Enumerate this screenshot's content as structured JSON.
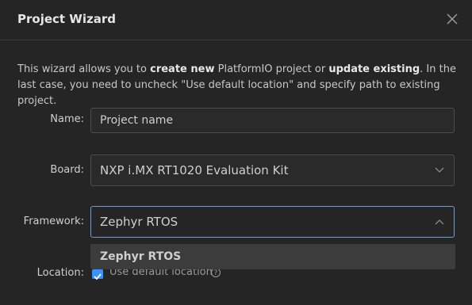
{
  "dialog": {
    "title": "Project Wizard",
    "close_icon": "close-icon"
  },
  "intro": {
    "part1": "This wizard allows you to ",
    "bold1": "create new",
    "part2": " PlatformIO project or ",
    "bold2": "update existing",
    "part3": ". In the last case, you need to uncheck \"Use default location\" and specify path to existing project."
  },
  "form": {
    "name": {
      "label": "Name:",
      "value": "Project name"
    },
    "board": {
      "label": "Board:",
      "value": "NXP i.MX RT1020 Evaluation Kit"
    },
    "framework": {
      "label": "Framework:",
      "value": "Zephyr RTOS",
      "options": [
        "Zephyr RTOS"
      ]
    },
    "location": {
      "label": "Location:",
      "checkbox_label": "Use default location",
      "checked": true
    }
  },
  "colors": {
    "background": "#252526",
    "accent": "#3794ff",
    "focus_border": "#6b9fd4"
  }
}
